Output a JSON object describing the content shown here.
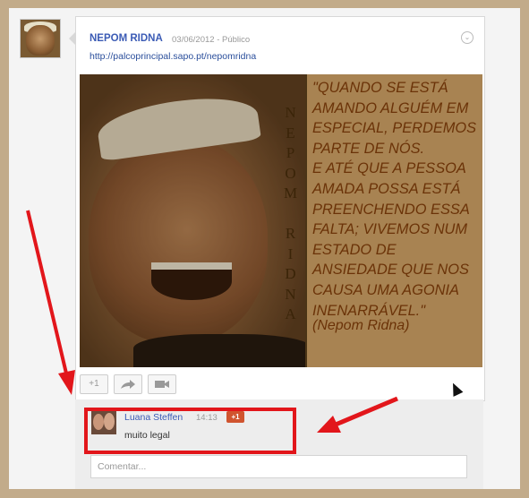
{
  "post": {
    "author": "NEPOM RIDNA",
    "date": "03/06/2012",
    "separator": "-",
    "visibility": "Público",
    "link": "http://palcoprincipal.sapo.pt/nepomridna",
    "image": {
      "vertical_name": "NEPOM RIDNA",
      "quote": "\"QUANDO SE ESTÁ\nAMANDO ALGUÉM EM\nESPECIAL, PERDEMOS\nPARTE DE NÓS.\nE ATÉ QUE A PESSOA\nAMADA POSSA ESTÁ\nPREENCHENDO ESSA\nFALTA; VIVEMOS NUM\nESTADO DE\nANSIEDADE QUE NOS\nCAUSA UMA AGONIA\nINENARRÁVEL.\"",
      "quote_author": "(Nepom Ridna)"
    },
    "actions": {
      "plus_one": "+1",
      "share_icon": "share-arrow-icon",
      "hangout_icon": "video-camera-icon"
    },
    "menu_icon": "chevron-down-icon"
  },
  "comment": {
    "author": "Luana Steffen",
    "time": "14:13",
    "plus_badge": "+1",
    "text": "muito legal"
  },
  "comment_input": {
    "placeholder": "Comentar..."
  },
  "colors": {
    "annotation": "#e2161b",
    "link": "#3b5bb5",
    "quote_text": "#6b3308"
  }
}
